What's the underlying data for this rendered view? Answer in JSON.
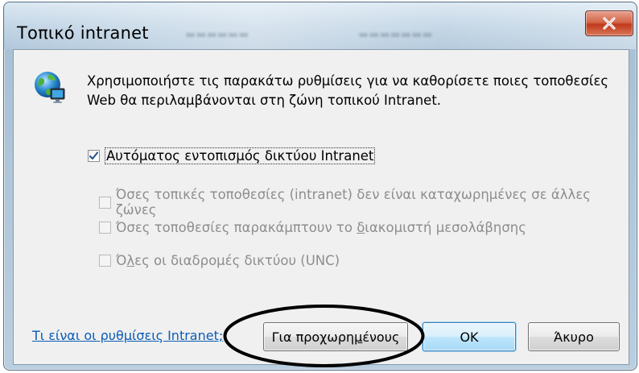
{
  "window": {
    "title": "Τοπικό intranet",
    "close_icon": "close-x-icon"
  },
  "dialog": {
    "icon": "globe-network-icon",
    "description": "Χρησιμοποιήστε τις παρακάτω ρυθμίσεις για να καθορίσετε ποιες τοποθεσίες Web θα περιλαμβάνονται στη ζώνη τοπικού Intranet.",
    "options": [
      {
        "label": "Αυτόματος εντοπισμός δικτύου Intranet",
        "checked": true,
        "enabled": true
      },
      {
        "label": "Όσες τοπικές τοποθεσίες (intranet) δεν είναι καταχωρημένες σε άλλες ζώνες",
        "checked": false,
        "enabled": false
      },
      {
        "label_before": "Όσες τοποθεσίες παρακάμπτουν το ",
        "label_underline": "δ",
        "label_after": "ιακομιστή μεσολάβησης",
        "checked": false,
        "enabled": false
      },
      {
        "label_before": "Ό",
        "label_underline": "λ",
        "label_after": "ες οι διαδρομές δικτύου (UNC)",
        "checked": false,
        "enabled": false
      }
    ],
    "help_link": "Τι είναι οι ρυθμίσεις Intranet;",
    "buttons": {
      "advanced_before": "Για προχωρη",
      "advanced_underline": "μ",
      "advanced_after": "ένους",
      "ok": "OK",
      "cancel": "Άκυρο"
    }
  },
  "colors": {
    "link": "#0b5cb8",
    "disabled_text": "#8d8d8d",
    "close_button": "#c2391b",
    "annotation": "#000000"
  }
}
